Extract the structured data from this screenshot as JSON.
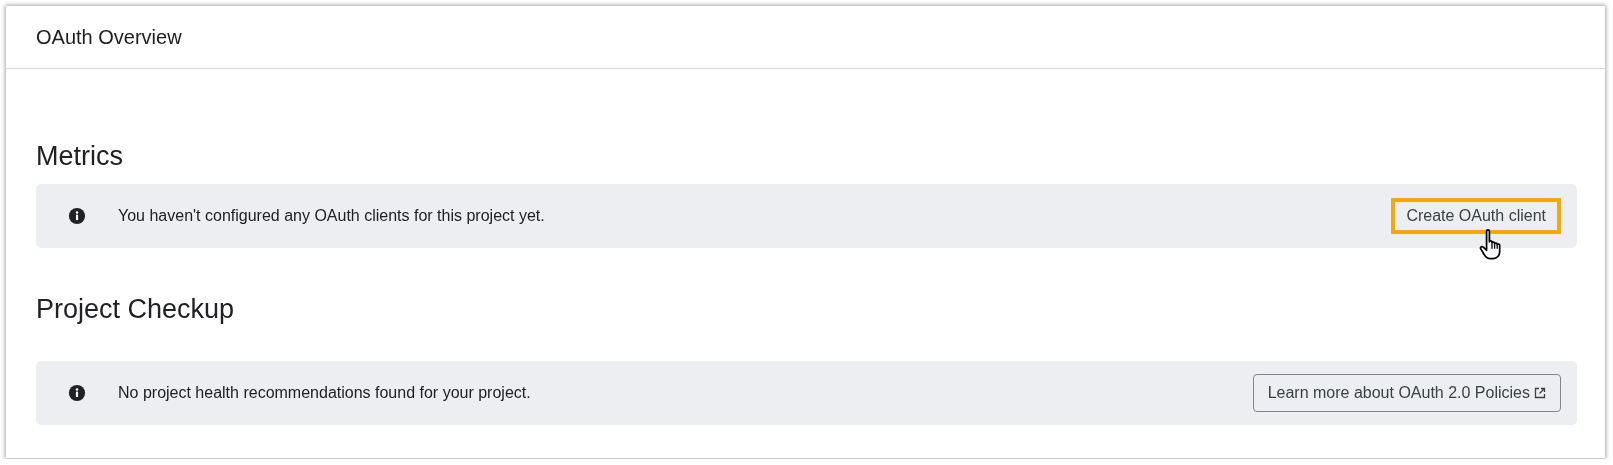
{
  "header": {
    "title": "OAuth Overview"
  },
  "sections": [
    {
      "heading": "Metrics",
      "message": "You haven't configured any OAuth clients for this project yet.",
      "action": {
        "label": "Create OAuth client",
        "kind": "text",
        "highlighted": true,
        "hovered": true
      }
    },
    {
      "heading": "Project Checkup",
      "message": "No project health recommendations found for your project.",
      "action": {
        "label": "Learn more about OAuth 2.0 Policies",
        "kind": "outlined-external",
        "highlighted": false
      }
    }
  ]
}
